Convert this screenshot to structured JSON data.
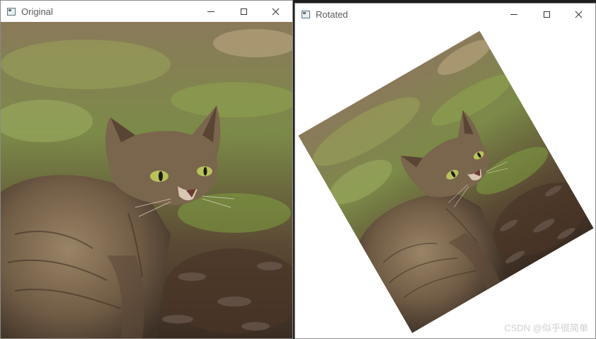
{
  "windows": [
    {
      "title": "Original"
    },
    {
      "title": "Rotated"
    }
  ],
  "images": {
    "original": {
      "subject": "cat-photo",
      "rotation_degrees": 0
    },
    "rotated": {
      "subject": "cat-photo",
      "rotation_degrees": 30
    }
  },
  "watermark": {
    "text": "CSDN @似乎很简单"
  },
  "icons": {
    "app": "window-app-icon",
    "minimize": "minimize-icon",
    "maximize": "maximize-icon",
    "close": "close-icon"
  }
}
